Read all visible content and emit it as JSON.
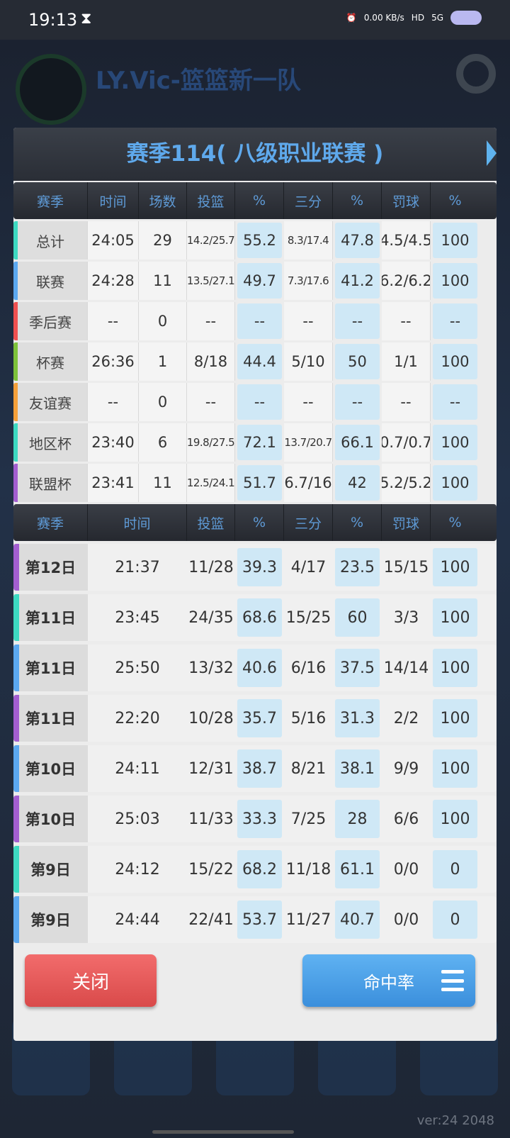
{
  "status": {
    "time": "19:13",
    "hourglass": "⧗",
    "net_speed": "0.00 KB/s",
    "hd": "HD",
    "signal": "5G"
  },
  "background": {
    "team_title": "LY.Vic-篮篮新一队"
  },
  "dialog": {
    "title": "赛季114( 八级职业联赛 )"
  },
  "summary_headers": [
    "赛季",
    "时间",
    "场数",
    "投篮",
    "%",
    "三分",
    "%",
    "罚球",
    "%"
  ],
  "summary_rows": [
    {
      "label": "总计",
      "time": "24:05",
      "games": "29",
      "fg": "14.2/25.7",
      "fg_pct": "55.2",
      "three": "8.3/17.4",
      "three_pct": "47.8",
      "ft": "4.5/4.5",
      "ft_pct": "100",
      "color": "#3dd9c1"
    },
    {
      "label": "联赛",
      "time": "24:28",
      "games": "11",
      "fg": "13.5/27.1",
      "fg_pct": "49.7",
      "three": "7.3/17.6",
      "three_pct": "41.2",
      "ft": "6.2/6.2",
      "ft_pct": "100",
      "color": "#5ba8f0"
    },
    {
      "label": "季后赛",
      "time": "--",
      "games": "0",
      "fg": "--",
      "fg_pct": "--",
      "three": "--",
      "three_pct": "--",
      "ft": "--",
      "ft_pct": "--",
      "color": "#f05050"
    },
    {
      "label": "杯赛",
      "time": "26:36",
      "games": "1",
      "fg": "8/18",
      "fg_pct": "44.4",
      "three": "5/10",
      "three_pct": "50",
      "ft": "1/1",
      "ft_pct": "100",
      "color": "#7dc23a"
    },
    {
      "label": "友谊赛",
      "time": "--",
      "games": "0",
      "fg": "--",
      "fg_pct": "--",
      "three": "--",
      "three_pct": "--",
      "ft": "--",
      "ft_pct": "--",
      "color": "#f5a03a"
    },
    {
      "label": "地区杯",
      "time": "23:40",
      "games": "6",
      "fg": "19.8/27.5",
      "fg_pct": "72.1",
      "three": "13.7/20.7",
      "three_pct": "66.1",
      "ft": "0.7/0.7",
      "ft_pct": "100",
      "color": "#3dd9c1"
    },
    {
      "label": "联盟杯",
      "time": "23:41",
      "games": "11",
      "fg": "12.5/24.1",
      "fg_pct": "51.7",
      "three": "6.7/16",
      "three_pct": "42",
      "ft": "5.2/5.2",
      "ft_pct": "100",
      "color": "#a35ed0"
    }
  ],
  "game_headers": [
    "赛季",
    "时间",
    "投篮",
    "%",
    "三分",
    "%",
    "罚球",
    "%"
  ],
  "game_rows": [
    {
      "label": "第12日",
      "time": "21:37",
      "fg": "11/28",
      "fg_pct": "39.3",
      "three": "4/17",
      "three_pct": "23.5",
      "ft": "15/15",
      "ft_pct": "100",
      "color": "#a35ed0"
    },
    {
      "label": "第11日",
      "time": "23:45",
      "fg": "24/35",
      "fg_pct": "68.6",
      "three": "15/25",
      "three_pct": "60",
      "ft": "3/3",
      "ft_pct": "100",
      "color": "#3dd9c1"
    },
    {
      "label": "第11日",
      "time": "25:50",
      "fg": "13/32",
      "fg_pct": "40.6",
      "three": "6/16",
      "three_pct": "37.5",
      "ft": "14/14",
      "ft_pct": "100",
      "color": "#5ba8f0"
    },
    {
      "label": "第11日",
      "time": "22:20",
      "fg": "10/28",
      "fg_pct": "35.7",
      "three": "5/16",
      "three_pct": "31.3",
      "ft": "2/2",
      "ft_pct": "100",
      "color": "#a35ed0"
    },
    {
      "label": "第10日",
      "time": "24:11",
      "fg": "12/31",
      "fg_pct": "38.7",
      "three": "8/21",
      "three_pct": "38.1",
      "ft": "9/9",
      "ft_pct": "100",
      "color": "#5ba8f0"
    },
    {
      "label": "第10日",
      "time": "25:03",
      "fg": "11/33",
      "fg_pct": "33.3",
      "three": "7/25",
      "three_pct": "28",
      "ft": "6/6",
      "ft_pct": "100",
      "color": "#a35ed0"
    },
    {
      "label": "第9日",
      "time": "24:12",
      "fg": "15/22",
      "fg_pct": "68.2",
      "three": "11/18",
      "three_pct": "61.1",
      "ft": "0/0",
      "ft_pct": "0",
      "color": "#3dd9c1"
    },
    {
      "label": "第9日",
      "time": "24:44",
      "fg": "22/41",
      "fg_pct": "53.7",
      "three": "11/27",
      "three_pct": "40.7",
      "ft": "0/0",
      "ft_pct": "0",
      "color": "#5ba8f0"
    }
  ],
  "buttons": {
    "close": "关闭",
    "rate": "命中率"
  },
  "version": "ver:24  2048"
}
